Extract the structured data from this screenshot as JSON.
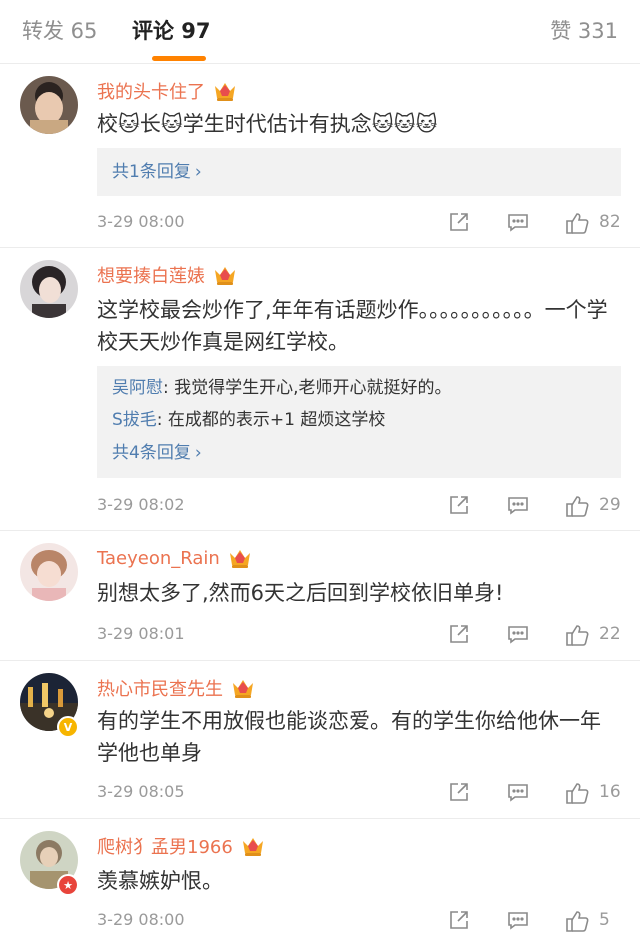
{
  "tabs": {
    "repost": "转发 65",
    "comment": "评论 97",
    "like": "赞 331"
  },
  "colors": {
    "accent": "#ff8200",
    "username": "#eb7350",
    "reply_name": "#507daf",
    "meta": "#9a9a9a"
  },
  "comments": [
    {
      "username": "我的头卡住了",
      "content": "校🐱长🐱学生时代估计有执念🐱🐱🐱",
      "replies": [],
      "reply_more": "共1条回复",
      "time": "3-29 08:00",
      "likes": "82"
    },
    {
      "username": "想要揍白莲婊",
      "content": "这学校最会炒作了,年年有话题炒作。。。。。。。。。。。一个学校天天炒作真是网红学校。",
      "replies": [
        {
          "name": "吴阿慰",
          "text": ": 我觉得学生开心,老师开心就挺好的。"
        },
        {
          "name": "S拔毛",
          "text": ": 在成都的表示+1 超烦这学校"
        }
      ],
      "reply_more": "共4条回复",
      "time": "3-29 08:02",
      "likes": "29"
    },
    {
      "username": "Taeyeon_Rain",
      "content": "别想太多了,然而6天之后回到学校依旧单身!",
      "replies": [],
      "reply_more": "",
      "time": "3-29 08:01",
      "likes": "22"
    },
    {
      "username": "热心市民查先生",
      "content": "有的学生不用放假也能谈恋爱。有的学生你给他休一年学他也单身",
      "replies": [],
      "reply_more": "",
      "time": "3-29 08:05",
      "likes": "16"
    },
    {
      "username": "爬树犭孟男1966",
      "content": "羡慕嫉妒恨。",
      "replies": [],
      "reply_more": "",
      "time": "3-29 08:00",
      "likes": "5"
    }
  ]
}
